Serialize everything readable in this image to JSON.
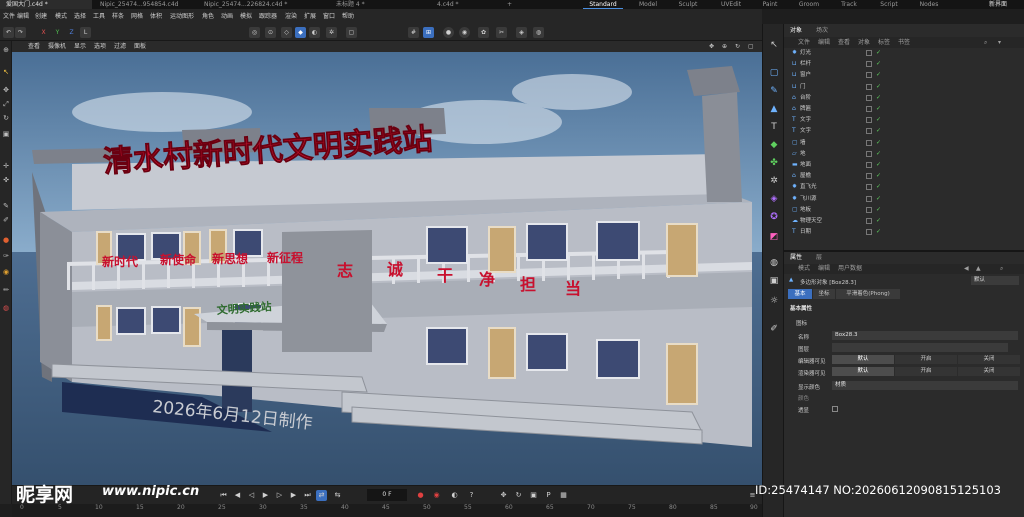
{
  "tabs": [
    {
      "label": "爱国大门.c4d *",
      "active": true
    },
    {
      "label": "Nipic_25474...954854.c4d *",
      "active": false
    },
    {
      "label": "Nipic_25474...226824.c4d *",
      "active": false
    },
    {
      "label": "未标题 4 *",
      "active": false
    },
    {
      "label": "4.c4d *",
      "active": false
    }
  ],
  "new_tab": "+",
  "layouts": [
    {
      "label": "Standard",
      "active": true
    },
    {
      "label": "Model",
      "active": false
    },
    {
      "label": "Sculpt",
      "active": false
    },
    {
      "label": "UVEdit",
      "active": false
    },
    {
      "label": "Paint",
      "active": false
    },
    {
      "label": "Groom",
      "active": false
    },
    {
      "label": "Track",
      "active": false
    },
    {
      "label": "Script",
      "active": false
    },
    {
      "label": "Nodes",
      "active": false
    }
  ],
  "new_layout": "新界面",
  "menubar": [
    "文件",
    "编辑",
    "创建",
    "模式",
    "选择",
    "工具",
    "样条",
    "网格",
    "体积",
    "运动图形",
    "角色",
    "动画",
    "模拟",
    "跟踪器",
    "渲染",
    "扩展",
    "窗口",
    "帮助"
  ],
  "toolbar": {
    "x": "X",
    "y": "Y",
    "z": "Z",
    "coord": "L"
  },
  "viewport_menu": [
    "查看",
    "摄像机",
    "显示",
    "选项",
    "过滤",
    "面板"
  ],
  "scene": {
    "roof_sign": "清水村新时代文明实践站",
    "balcony_banner": [
      "新时代",
      "新使命",
      "新思想",
      "新征程"
    ],
    "balcony_chars": [
      "志",
      "诚",
      "干",
      "净",
      "担",
      "当"
    ],
    "entrance_plaque": "文明实践站",
    "date_text": "2026年6月12日制作"
  },
  "timeline": {
    "frame": "0 F",
    "ticks": [
      "0",
      "5",
      "10",
      "15",
      "20",
      "25",
      "30",
      "35",
      "40",
      "45",
      "50",
      "55",
      "60",
      "65",
      "70",
      "75",
      "80",
      "85",
      "90"
    ]
  },
  "object_panel": {
    "tabs": [
      {
        "label": "对象",
        "active": true
      },
      {
        "label": "场次",
        "active": false
      }
    ],
    "menu": [
      "文件",
      "编辑",
      "查看",
      "对象",
      "标签",
      "书签"
    ],
    "objects": [
      {
        "name": "灯光",
        "icon": "light-icon"
      },
      {
        "name": "栏杆",
        "icon": "group-icon"
      },
      {
        "name": "窗户",
        "icon": "group-icon"
      },
      {
        "name": "门",
        "icon": "group-icon"
      },
      {
        "name": "台阶",
        "icon": "null-icon"
      },
      {
        "name": "牌匾",
        "icon": "null-icon"
      },
      {
        "name": "文字",
        "icon": "text-icon"
      },
      {
        "name": "文字",
        "icon": "text-icon"
      },
      {
        "name": "墙",
        "icon": "cube-icon"
      },
      {
        "name": "地",
        "icon": "plane-icon"
      },
      {
        "name": "地面",
        "icon": "floor-icon"
      },
      {
        "name": "屋檐",
        "icon": "null-icon"
      },
      {
        "name": "直飞光",
        "icon": "light-icon"
      },
      {
        "name": "飞川源",
        "icon": "light-icon"
      },
      {
        "name": "地板",
        "icon": "cube-icon"
      },
      {
        "name": "物理天空",
        "icon": "sky-icon"
      },
      {
        "name": "日期",
        "icon": "text-icon"
      }
    ]
  },
  "attr_panel": {
    "tabs": [
      {
        "label": "属性",
        "active": true
      },
      {
        "label": "层",
        "active": false
      }
    ],
    "menu": [
      "模式",
      "编辑",
      "用户数据"
    ],
    "object_title": "多边形对象 [Box28.3]",
    "preset": "默认",
    "subtabs": [
      {
        "label": "基本",
        "active": true
      },
      {
        "label": "坐标",
        "active": false
      },
      {
        "label": "平滑着色(Phong)",
        "active": false
      }
    ],
    "section": "基本属性",
    "subsection": "图标",
    "name_label": "名称",
    "name_value": "Box28.3",
    "layer_label": "图层",
    "editor_visible_label": "编辑器可见",
    "render_visible_label": "渲染器可见",
    "options": [
      "默认",
      "开启",
      "关闭"
    ],
    "color_label": "显示颜色",
    "color_value": "材质",
    "color2_label": "颜色",
    "xray_label": "透显"
  },
  "watermark": {
    "logo_text": "昵享网",
    "url_text": "www.nipic.cn",
    "id_text": "ID:25474147 NO:20260612090815125103"
  },
  "colors": {
    "accent": "#3b6fbf",
    "sign_red": "#c8102e",
    "check_green": "#5fd05f"
  }
}
